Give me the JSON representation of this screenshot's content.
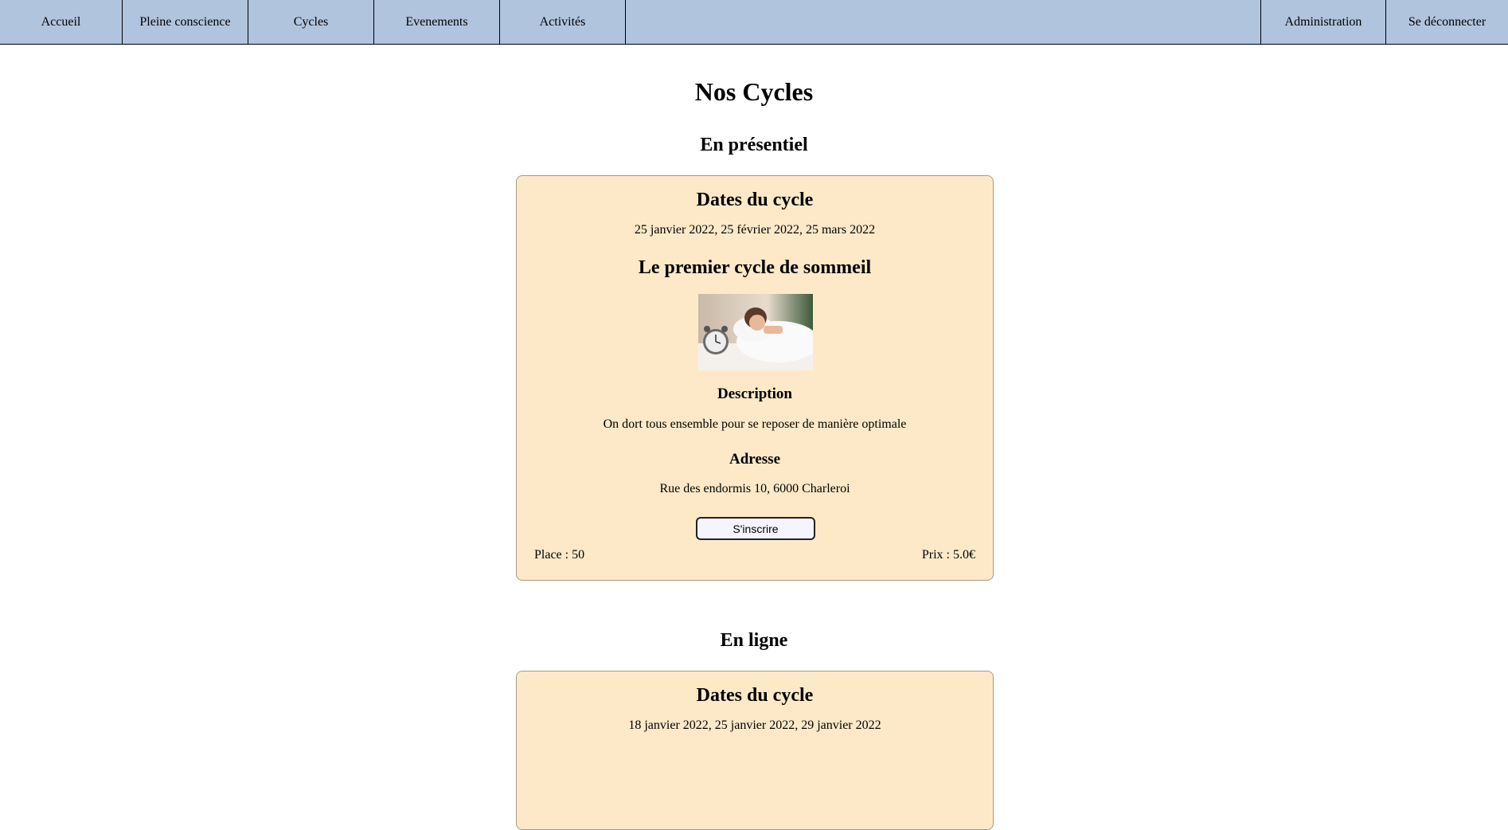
{
  "nav": {
    "left": [
      "Accueil",
      "Pleine conscience",
      "Cycles",
      "Evenements",
      "Activités"
    ],
    "admin": "Administration",
    "logout": "Se déconnecter"
  },
  "page": {
    "title": "Nos Cycles",
    "section_presentiel": "En présentiel",
    "section_enligne": "En ligne"
  },
  "cycles": [
    {
      "dates_heading": "Dates du cycle",
      "dates": "25 janvier 2022, 25 février 2022, 25 mars 2022",
      "name": "Le premier cycle de sommeil",
      "description_heading": "Description",
      "description": "On dort tous ensemble pour se reposer de manière optimale",
      "address_heading": "Adresse",
      "address": "Rue des endormis 10, 6000 Charleroi",
      "button": "S'inscrire",
      "place": "Place : 50",
      "prix": "Prix : 5.0€",
      "image_icon": "sleeping-woman-photo"
    },
    {
      "dates_heading": "Dates du cycle",
      "dates": "18 janvier 2022, 25 janvier 2022, 29 janvier 2022"
    }
  ]
}
